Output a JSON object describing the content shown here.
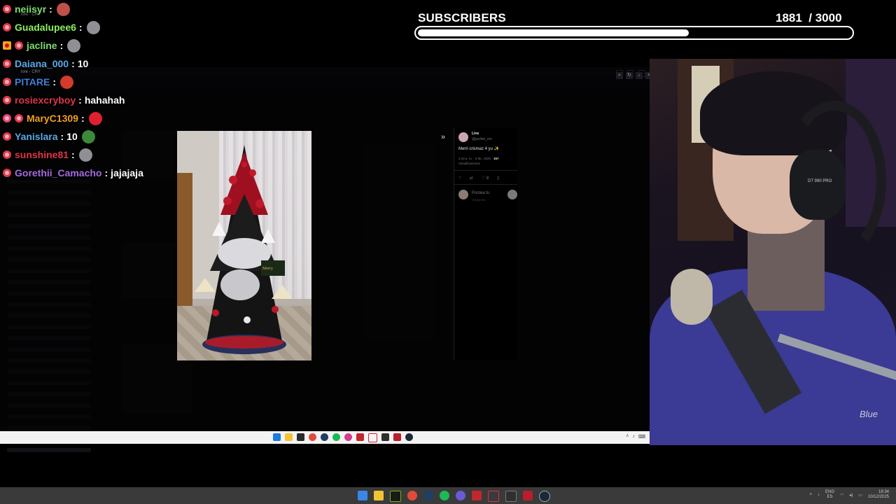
{
  "subscribers": {
    "title": "SUBSCRIBERS",
    "current": "1881",
    "goal": "/ 3000",
    "progress_fraction": 0.627,
    "bar_color": "#ffffff"
  },
  "chat": [
    {
      "user": "neiisyr",
      "color": "#7dde6e",
      "badges": [
        "sub-badge"
      ],
      "message": "",
      "emote": "face-emote"
    },
    {
      "user": "Guadalupee6",
      "color": "#8cf060",
      "badges": [
        "sub-badge"
      ],
      "message": "",
      "emote": "anime-emote"
    },
    {
      "user": "jacline",
      "color": "#7dde6e",
      "badges": [
        "gift-badge",
        "sub-badge"
      ],
      "message": "",
      "emote": "anime-emote"
    },
    {
      "user": "Daiana_000",
      "color": "#5aa9e6",
      "badges": [
        "sub-badge"
      ],
      "message": "10",
      "emote": ""
    },
    {
      "user": "PITARE",
      "color": "#3f7fd6",
      "badges": [
        "sub-badge"
      ],
      "message": "",
      "emote": "devil-emote"
    },
    {
      "user": "rosiexcryboy",
      "color": "#e0344a",
      "badges": [
        "sub-badge"
      ],
      "message": "hahahah",
      "emote": ""
    },
    {
      "user": "MaryC1309",
      "color": "#f0a020",
      "badges": [
        "sub-badge-pink",
        "sub-badge"
      ],
      "message": "",
      "emote": "heart-emote"
    },
    {
      "user": "Yanislara",
      "color": "#5aa9e6",
      "badges": [
        "sub-badge"
      ],
      "message": "10",
      "emote": "santa-emote"
    },
    {
      "user": "sunshine81",
      "color": "#e0344a",
      "badges": [
        "sub-badge"
      ],
      "message": "",
      "emote": "anime-emote"
    },
    {
      "user": "Gorethii_Camacho",
      "color": "#a66ae0",
      "badges": [
        "sub-badge"
      ],
      "message": "jajajaja",
      "emote": ""
    }
  ],
  "chat_overlay": {
    "line1": "lore · CRY",
    "line2": "lore · CRY"
  },
  "tweet": {
    "name": "Line",
    "handle": "@jacline_mz",
    "text": "Merri crismaz 4 yu ✨",
    "meta": "3:18 p. m. · 9 dic. 2025 ·",
    "views_count": "157",
    "views_label": "Visualizaciones",
    "reply_placeholder": "Postea tu",
    "reply_sub": "respuesta",
    "likes": "8"
  },
  "webcam": {
    "headphones_label": "DT 990 PRO",
    "mic_brand": "Blue"
  },
  "outer_tray": {
    "lang_top": "ENG",
    "lang_bottom": "ES",
    "time": "18:34",
    "date": "10/12/2025"
  },
  "colors": {
    "taskbar_outer": "#3a3a3a",
    "taskbar_inner": "#f3f3f3",
    "hoodie": "#3b3a94"
  }
}
